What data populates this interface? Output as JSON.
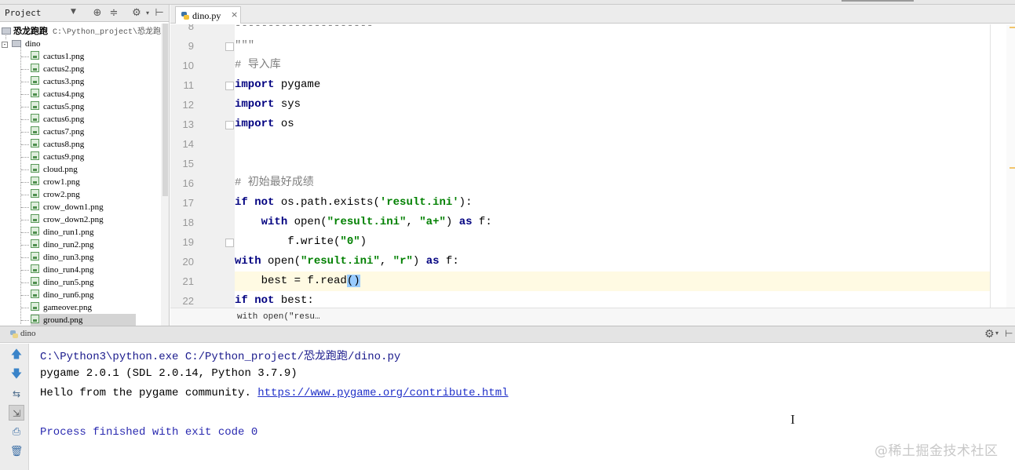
{
  "project_panel": {
    "header_label": "Project",
    "root": {
      "name": "恐龙跑跑",
      "path": "C:\\Python_project\\恐龙跑"
    },
    "folder": "dino",
    "files": [
      "cactus1.png",
      "cactus2.png",
      "cactus3.png",
      "cactus4.png",
      "cactus5.png",
      "cactus6.png",
      "cactus7.png",
      "cactus8.png",
      "cactus9.png",
      "cloud.png",
      "crow1.png",
      "crow2.png",
      "crow_down1.png",
      "crow_down2.png",
      "dino_run1.png",
      "dino_run2.png",
      "dino_run3.png",
      "dino_run4.png",
      "dino_run5.png",
      "dino_run6.png",
      "gameover.png",
      "ground.png"
    ],
    "selected_file": "ground.png"
  },
  "editor": {
    "tab_name": "dino.py",
    "line_numbers": [
      "8",
      "9",
      "10",
      "11",
      "12",
      "13",
      "14",
      "15",
      "16",
      "17",
      "18",
      "19",
      "20",
      "21",
      "22"
    ],
    "lines": [
      [
        {
          "t": "---------------------",
          "c": "cmt"
        }
      ],
      [
        {
          "t": "\"\"\"",
          "c": "cmt"
        }
      ],
      [
        {
          "t": "# 导入库",
          "c": "cmt"
        }
      ],
      [
        {
          "t": "import",
          "c": "kw"
        },
        {
          "t": " pygame",
          "c": ""
        }
      ],
      [
        {
          "t": "import",
          "c": "kw"
        },
        {
          "t": " sys",
          "c": ""
        }
      ],
      [
        {
          "t": "import",
          "c": "kw"
        },
        {
          "t": " os",
          "c": ""
        }
      ],
      [],
      [],
      [
        {
          "t": "# 初始最好成绩",
          "c": "cmt"
        }
      ],
      [
        {
          "t": "if not",
          "c": "kw"
        },
        {
          "t": " os.path.exists(",
          "c": ""
        },
        {
          "t": "'result.ini'",
          "c": "str"
        },
        {
          "t": "):",
          "c": ""
        }
      ],
      [
        {
          "t": "    ",
          "c": ""
        },
        {
          "t": "with",
          "c": "kw"
        },
        {
          "t": " open(",
          "c": ""
        },
        {
          "t": "\"result.ini\"",
          "c": "str"
        },
        {
          "t": ", ",
          "c": ""
        },
        {
          "t": "\"a+\"",
          "c": "str"
        },
        {
          "t": ") ",
          "c": ""
        },
        {
          "t": "as",
          "c": "kw"
        },
        {
          "t": " f:",
          "c": ""
        }
      ],
      [
        {
          "t": "        f.write(",
          "c": ""
        },
        {
          "t": "\"0\"",
          "c": "str"
        },
        {
          "t": ")",
          "c": ""
        }
      ],
      [
        {
          "t": "with",
          "c": "kw"
        },
        {
          "t": " open(",
          "c": ""
        },
        {
          "t": "\"result.ini\"",
          "c": "str"
        },
        {
          "t": ", ",
          "c": ""
        },
        {
          "t": "\"r\"",
          "c": "str"
        },
        {
          "t": ") ",
          "c": ""
        },
        {
          "t": "as",
          "c": "kw"
        },
        {
          "t": " f:",
          "c": ""
        }
      ],
      [
        {
          "t": "    best = f.read",
          "c": ""
        },
        {
          "t": "()",
          "c": "hl"
        }
      ],
      [
        {
          "t": "if not",
          "c": "kw"
        },
        {
          "t": " best:",
          "c": ""
        }
      ]
    ],
    "current_line_index": 13,
    "breadcrumb": "with open(\"resu…"
  },
  "run_panel": {
    "config_name": "dino",
    "output": {
      "command": "C:\\Python3\\python.exe C:/Python_project/恐龙跑跑/dino.py",
      "pygame_version": "pygame 2.0.1 (SDL 2.0.14, Python 3.7.9)",
      "hello_prefix": "Hello from the pygame community. ",
      "hello_link": "https://www.pygame.org/contribute.html",
      "exit_message": "Process finished with exit code 0"
    }
  },
  "watermark": "@稀土掘金技术社区",
  "colors": {
    "keyword": "#000080",
    "string": "#008000",
    "comment": "#808080",
    "current_line": "#fffae3",
    "link": "#2030c8"
  }
}
